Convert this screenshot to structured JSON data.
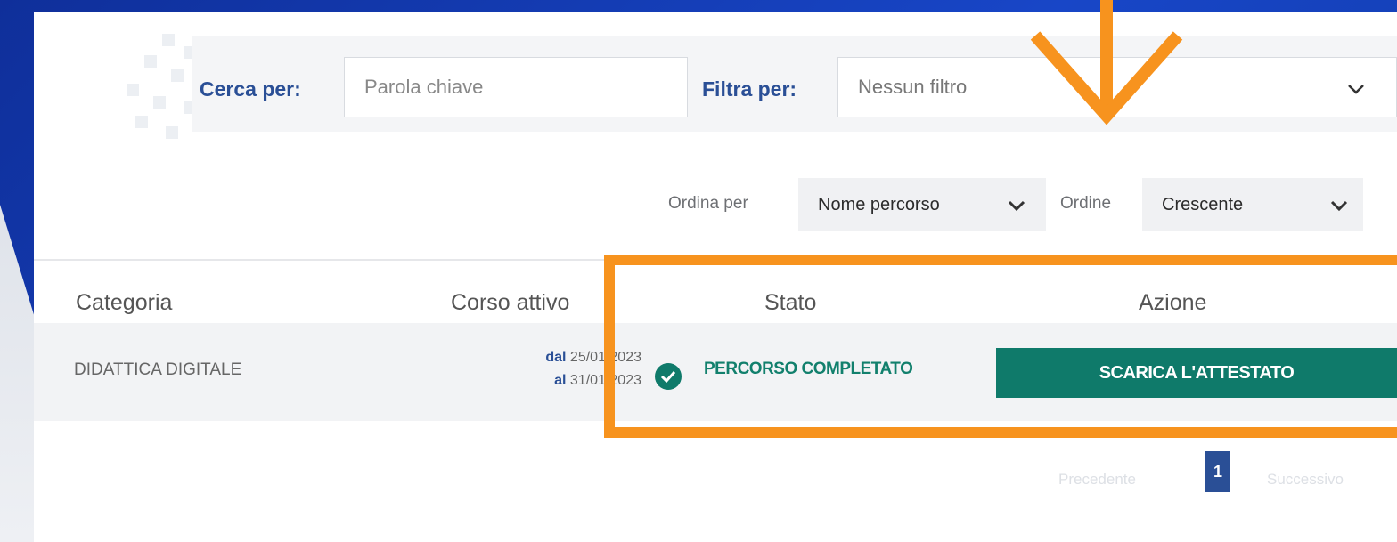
{
  "search": {
    "cerca_label": "Cerca per:",
    "cerca_placeholder": "Parola chiave",
    "filtra_label": "Filtra per:",
    "filtra_value": "Nessun filtro"
  },
  "sort": {
    "ordina_label": "Ordina per",
    "ordina_value": "Nome percorso",
    "ordine_label": "Ordine",
    "ordine_value": "Crescente"
  },
  "table": {
    "headers": {
      "categoria": "Categoria",
      "corso_attivo": "Corso attivo",
      "stato": "Stato",
      "azione": "Azione"
    },
    "rows": [
      {
        "categoria": "DIDATTICA DIGITALE",
        "dal_label": "dal",
        "dal": "25/01/2023",
        "al_label": "al",
        "al": "31/01/2023",
        "stato": "PERCORSO COMPLETATO",
        "azione": "SCARICA L'ATTESTATO"
      }
    ]
  },
  "pagination": {
    "prev": "Precedente",
    "current": "1",
    "next": "Successivo"
  },
  "colors": {
    "accent_blue": "#2a4f96",
    "success_green": "#0f7a6a",
    "annotation_orange": "#f7931e",
    "frame_blue": "#1846c7"
  },
  "icons": [
    "chevron-down-icon",
    "check-circle-icon",
    "arrow-down-icon"
  ]
}
